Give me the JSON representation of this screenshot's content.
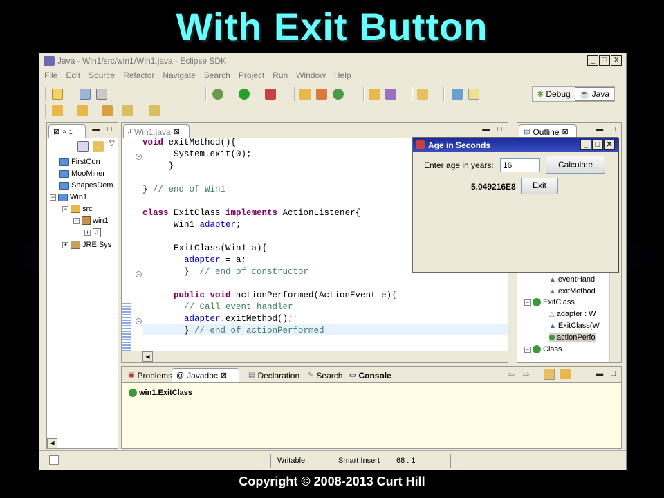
{
  "slide": {
    "title": "With Exit Button",
    "copyright": "Copyright © 2008-2013 Curt Hill"
  },
  "window": {
    "title": "Java - Win1/src/win1/Win1.java - Eclipse SDK",
    "buttons": [
      "_",
      "□",
      "X"
    ]
  },
  "menu": [
    "File",
    "Edit",
    "Source",
    "Refactor",
    "Navigate",
    "Search",
    "Project",
    "Run",
    "Window",
    "Help"
  ],
  "perspectives": {
    "debug": "Debug",
    "java": "Java"
  },
  "package_explorer": {
    "tab_label": "1",
    "items": [
      {
        "label": "FirstCon"
      },
      {
        "label": "MooMiner"
      },
      {
        "label": "ShapesDem"
      },
      {
        "label": "Win1"
      },
      {
        "label": "src"
      },
      {
        "label": "win1"
      },
      {
        "label": "J"
      },
      {
        "label": "JRE Sys"
      }
    ]
  },
  "editor": {
    "tab_label": "Win1.java",
    "lines": [
      {
        "a": "",
        "kw": "void",
        "b": " exitMethod(){",
        "fld": "",
        "c": "",
        "cm": ""
      },
      {
        "a": "      System.exit(0);",
        "kw": "",
        "b": "",
        "fld": "",
        "c": "",
        "cm": ""
      },
      {
        "a": "     }",
        "kw": "",
        "b": "",
        "fld": "",
        "c": "",
        "cm": ""
      },
      {
        "a": "",
        "kw": "",
        "b": "",
        "fld": "",
        "c": "",
        "cm": ""
      },
      {
        "a": "} ",
        "kw": "",
        "b": "",
        "fld": "",
        "c": "",
        "cm": "// end of Win1"
      },
      {
        "a": "",
        "kw": "",
        "b": "",
        "fld": "",
        "c": "",
        "cm": ""
      },
      {
        "a": "",
        "kw": "class",
        "b": " ExitClass ",
        "fld": "",
        "c": "",
        "cm": "",
        "kw2": "implements",
        "d": " ActionListener{"
      },
      {
        "a": "      Win1 ",
        "kw": "",
        "b": "",
        "fld": "adapter",
        "c": ";",
        "cm": ""
      },
      {
        "a": "",
        "kw": "",
        "b": "",
        "fld": "",
        "c": "",
        "cm": ""
      },
      {
        "a": "      ExitClass(Win1 a){",
        "kw": "",
        "b": "",
        "fld": "",
        "c": "",
        "cm": ""
      },
      {
        "a": "        ",
        "kw": "",
        "b": "",
        "fld": "adapter",
        "c": " = a;",
        "cm": ""
      },
      {
        "a": "        }  ",
        "kw": "",
        "b": "",
        "fld": "",
        "c": "",
        "cm": "// end of constructor"
      },
      {
        "a": "",
        "kw": "",
        "b": "",
        "fld": "",
        "c": "",
        "cm": ""
      },
      {
        "a": "      ",
        "kw": "public void",
        "b": " actionPerformed(ActionEvent e){",
        "fld": "",
        "c": "",
        "cm": ""
      },
      {
        "a": "        ",
        "kw": "",
        "b": "",
        "fld": "",
        "c": "",
        "cm": "// Call event handler"
      },
      {
        "a": "        ",
        "kw": "",
        "b": "",
        "fld": "adapter",
        "c": ".exitMethod();",
        "cm": ""
      },
      {
        "a": "        } ",
        "kw": "",
        "b": "",
        "fld": "",
        "c": "",
        "cm": "// end of actionPerformed"
      }
    ]
  },
  "outline": {
    "tab_label": "Outline",
    "items": [
      {
        "label": "eventHand"
      },
      {
        "label": "exitMethod"
      },
      {
        "label": "ExitClass"
      },
      {
        "label": "adapter : W"
      },
      {
        "label": "ExitClass(W"
      },
      {
        "label": "actionPerfo"
      },
      {
        "label": "Class"
      }
    ]
  },
  "bottom_tabs": [
    "Problems",
    "Javadoc",
    "Declaration",
    "Search",
    "Console"
  ],
  "javadoc": {
    "content": "win1.ExitClass"
  },
  "status": {
    "writable": "Writable",
    "insert_mode": "Smart Insert",
    "position": "68 : 1"
  },
  "dialog": {
    "title": "Age in Seconds",
    "prompt": "Enter age in years:",
    "input_value": "16",
    "calculate": "Calculate",
    "result": "5.049216E8",
    "exit": "Exit"
  }
}
